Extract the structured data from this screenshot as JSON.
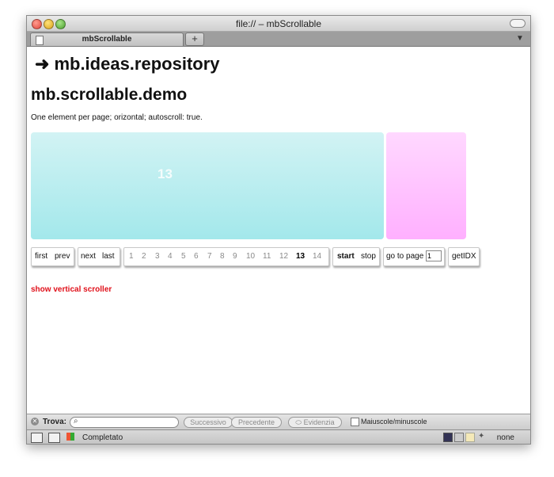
{
  "window": {
    "title": "file:// – mbScrollable"
  },
  "tabs": [
    {
      "label": "mbScrollable"
    }
  ],
  "tabbar": {
    "new_tab": "+"
  },
  "page": {
    "heading2_arrow": "➜",
    "heading2": "mb.ideas.repository",
    "heading1": "mb.scrollable.demo",
    "description": "One element per page; orizontal; autoscroll: true.",
    "slide_number": "13",
    "slide_colors": {
      "current": "#b9eef0",
      "next": "#ffc6ff"
    }
  },
  "nav": {
    "first": "first",
    "prev": "prev",
    "next": "next",
    "last": "last",
    "pages": [
      "1",
      "2",
      "3",
      "4",
      "5",
      "6",
      "7",
      "8",
      "9",
      "10",
      "11",
      "12",
      "13",
      "14"
    ],
    "active_page": "13",
    "start": "start",
    "stop": "stop",
    "go_to_page": "go to page",
    "go_to_page_value": "1",
    "getidx": "getIDX"
  },
  "links": {
    "vertical": "show vertical scroller"
  },
  "findbar": {
    "label": "Trova:",
    "next": "Successivo",
    "prev": "Precedente",
    "highlight": "Evidenzia",
    "match_case": "Maiuscole/minuscole"
  },
  "statusbar": {
    "status": "Completato",
    "right": "none"
  }
}
